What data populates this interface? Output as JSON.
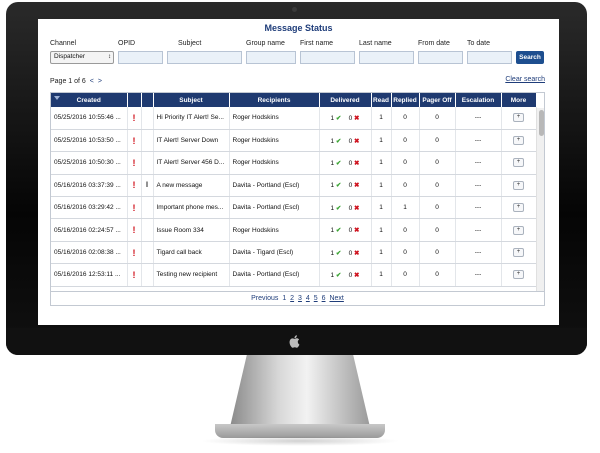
{
  "title": "Message Status",
  "filters": {
    "channel_label": "Channel",
    "channel_value": "Dispatcher",
    "opid_label": "OPID",
    "subject_label": "Subject",
    "group_label": "Group name",
    "first_label": "First name",
    "last_label": "Last name",
    "from_label": "From date",
    "to_label": "To date",
    "search_label": "Search"
  },
  "page_info": {
    "text": "Page 1 of 6",
    "prev": "<",
    "next": ">"
  },
  "clear_search": "Clear search",
  "table": {
    "headers": [
      "Created",
      "",
      "",
      "Subject",
      "Recipients",
      "Delivered",
      "Read",
      "Replied",
      "Pager Off",
      "Escalation",
      "More"
    ],
    "rows": [
      {
        "created": "05/25/2016 10:55:46 ...",
        "priority": "!",
        "attach": "",
        "subject": "Hi Priority IT Alert! Se...",
        "recipients": "Roger Hodskins",
        "delivered_ok": "1",
        "delivered_fail": "0",
        "read": "1",
        "replied": "0",
        "pager_off": "0",
        "escalation": "---",
        "more": "+"
      },
      {
        "created": "05/25/2016 10:53:50 ...",
        "priority": "!",
        "attach": "",
        "subject": "IT Alert! Server Down",
        "recipients": "Roger Hodskins",
        "delivered_ok": "1",
        "delivered_fail": "0",
        "read": "1",
        "replied": "0",
        "pager_off": "0",
        "escalation": "---",
        "more": "+"
      },
      {
        "created": "05/25/2016 10:50:30 ...",
        "priority": "!",
        "attach": "",
        "subject": "IT Alert! Server 456 D...",
        "recipients": "Roger Hodskins",
        "delivered_ok": "1",
        "delivered_fail": "0",
        "read": "1",
        "replied": "0",
        "pager_off": "0",
        "escalation": "---",
        "more": "+"
      },
      {
        "created": "05/16/2016 03:37:39 ...",
        "priority": "!",
        "attach": "‖",
        "subject": "A new message",
        "recipients": "Davita - Portland (Escl)",
        "delivered_ok": "1",
        "delivered_fail": "0",
        "read": "1",
        "replied": "0",
        "pager_off": "0",
        "escalation": "---",
        "more": "+"
      },
      {
        "created": "05/16/2016 03:29:42 ...",
        "priority": "!",
        "attach": "",
        "subject": "Important phone mes...",
        "recipients": "Davita - Portland (Escl)",
        "delivered_ok": "1",
        "delivered_fail": "0",
        "read": "1",
        "replied": "1",
        "pager_off": "0",
        "escalation": "---",
        "more": "+"
      },
      {
        "created": "05/16/2016 02:24:57 ...",
        "priority": "!",
        "attach": "",
        "subject": "Issue Room 334",
        "recipients": "Roger Hodskins",
        "delivered_ok": "1",
        "delivered_fail": "0",
        "read": "1",
        "replied": "0",
        "pager_off": "0",
        "escalation": "---",
        "more": "+"
      },
      {
        "created": "05/16/2016 02:08:38 ...",
        "priority": "!",
        "attach": "",
        "subject": "Tigard call back",
        "recipients": "Davita - Tigard (Escl)",
        "delivered_ok": "1",
        "delivered_fail": "0",
        "read": "1",
        "replied": "0",
        "pager_off": "0",
        "escalation": "---",
        "more": "+"
      },
      {
        "created": "05/16/2016 12:53:11 ...",
        "priority": "!",
        "attach": "",
        "subject": "Testing new recipient",
        "recipients": "Davita - Portland (Escl)",
        "delivered_ok": "1",
        "delivered_fail": "0",
        "read": "1",
        "replied": "0",
        "pager_off": "0",
        "escalation": "---",
        "more": "+"
      }
    ]
  },
  "pagination": {
    "previous": "Previous",
    "pages": [
      "1",
      "2",
      "3",
      "4",
      "5",
      "6"
    ],
    "next": "Next"
  },
  "icons": {
    "check": "✔",
    "cross": "✖",
    "select_arrows": "↕"
  },
  "colors": {
    "header_bg": "#1f3a70",
    "title": "#1f3d7a",
    "priority": "#d0101a",
    "delivered_ok": "#3aa332",
    "delivered_fail": "#cf1420"
  }
}
